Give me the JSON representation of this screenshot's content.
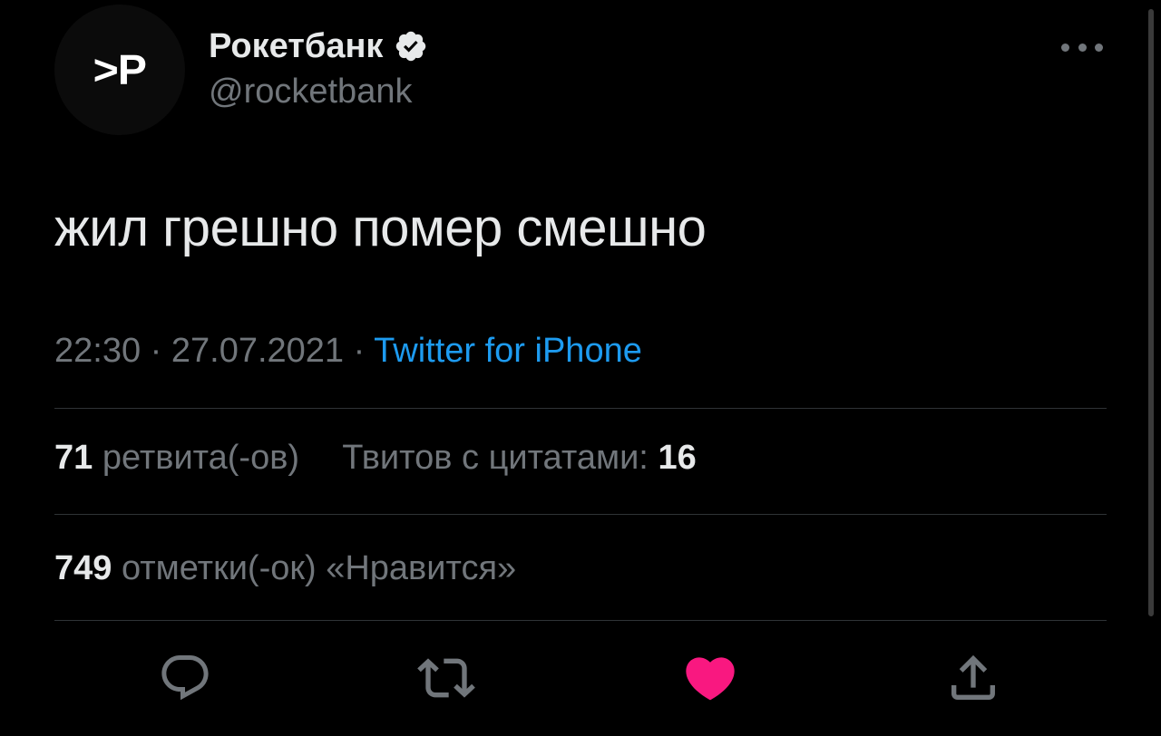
{
  "author": {
    "avatar_text": ">P",
    "display_name": "Рокетбанк",
    "handle": "@rocketbank",
    "verified": true
  },
  "tweet": {
    "text": "жил грешно помер смешно",
    "time": "22:30",
    "separator": "·",
    "date": "27.07.2021",
    "source": "Twitter for iPhone"
  },
  "stats": {
    "retweets_count": "71",
    "retweets_label": "ретвита(-ов)",
    "quotes_label": "Твитов с цитатами:",
    "quotes_count": "16",
    "likes_count": "749",
    "likes_label": "отметки(-ок) «Нравится»"
  },
  "actions": {
    "reply": "reply-icon",
    "retweet": "retweet-icon",
    "like": "heart-icon",
    "share": "share-icon",
    "liked": true
  },
  "colors": {
    "background": "#000000",
    "text": "#e7e9ea",
    "muted": "#71767b",
    "link": "#1d9bf0",
    "like": "#f91880",
    "divider": "#2f3336"
  }
}
